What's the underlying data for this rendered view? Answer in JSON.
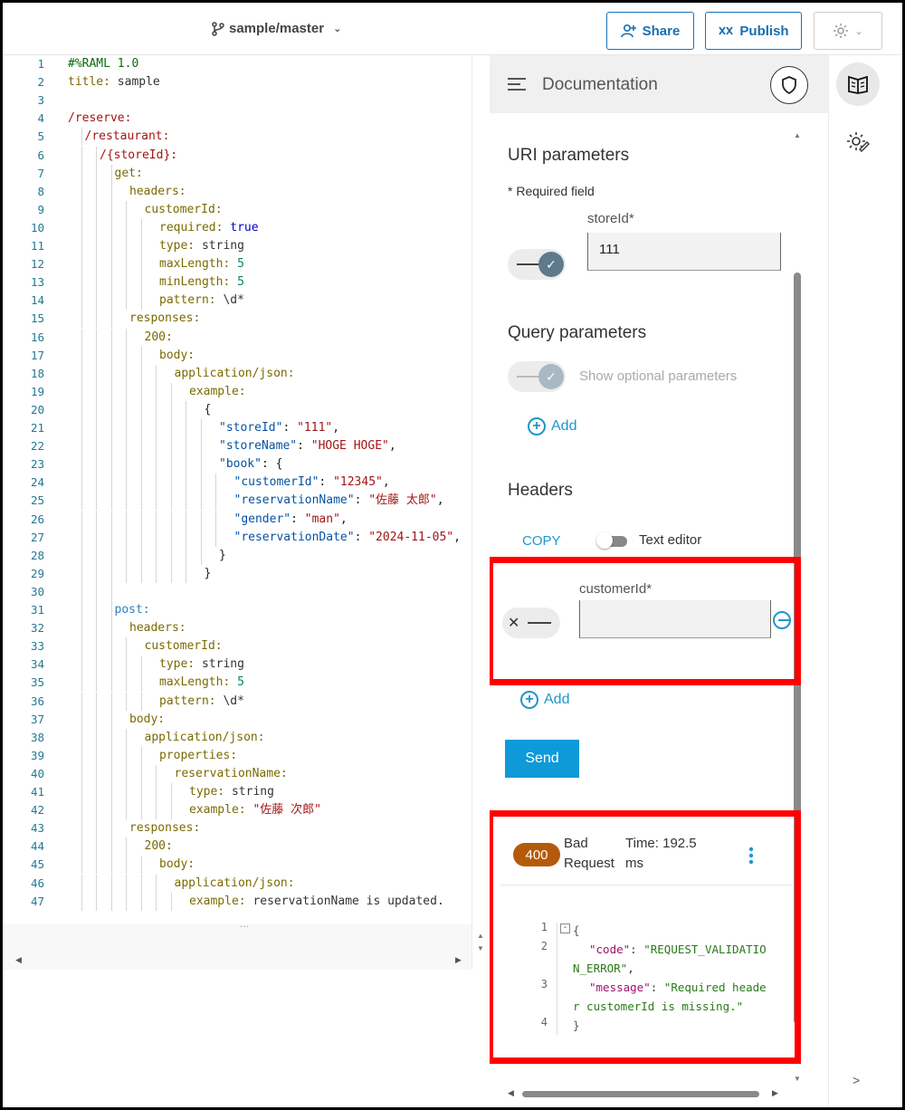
{
  "topbar": {
    "branch": "sample/master",
    "share_label": "Share",
    "publish_label": "Publish"
  },
  "editor": {
    "lines": [
      {
        "n": "1"
      },
      {
        "n": "2"
      },
      {
        "n": "3"
      },
      {
        "n": "4"
      },
      {
        "n": "5"
      },
      {
        "n": "6"
      },
      {
        "n": "7"
      },
      {
        "n": "8"
      },
      {
        "n": "9"
      },
      {
        "n": "10"
      },
      {
        "n": "11"
      },
      {
        "n": "12"
      },
      {
        "n": "13"
      },
      {
        "n": "14"
      },
      {
        "n": "15"
      },
      {
        "n": "16"
      },
      {
        "n": "17"
      },
      {
        "n": "18"
      },
      {
        "n": "19"
      },
      {
        "n": "20"
      },
      {
        "n": "21"
      },
      {
        "n": "22"
      },
      {
        "n": "23"
      },
      {
        "n": "24"
      },
      {
        "n": "25"
      },
      {
        "n": "26"
      },
      {
        "n": "27"
      },
      {
        "n": "28"
      },
      {
        "n": "29"
      },
      {
        "n": "30"
      },
      {
        "n": "31"
      },
      {
        "n": "32"
      },
      {
        "n": "33"
      },
      {
        "n": "34"
      },
      {
        "n": "35"
      },
      {
        "n": "36"
      },
      {
        "n": "37"
      },
      {
        "n": "38"
      },
      {
        "n": "39"
      },
      {
        "n": "40"
      },
      {
        "n": "41"
      },
      {
        "n": "42"
      },
      {
        "n": "43"
      },
      {
        "n": "44"
      },
      {
        "n": "45"
      },
      {
        "n": "46"
      },
      {
        "n": "47"
      }
    ],
    "code": {
      "l1": "#%RAML 1.0",
      "l2a": "title:",
      "l2b": " sample",
      "l4": "/reserve:",
      "l5": "/restaurant:",
      "l6": "/{storeId}:",
      "l7": "get:",
      "l8": "headers:",
      "l9": "customerId:",
      "l10a": "required:",
      "l10b": " true",
      "l11a": "type:",
      "l11b": " string",
      "l12a": "maxLength:",
      "l12b": " 5",
      "l13a": "minLength:",
      "l13b": " 5",
      "l14a": "pattern:",
      "l14b": " \\d*",
      "l15": "responses:",
      "l16": "200:",
      "l17": "body:",
      "l18": "application/json:",
      "l19": "example:",
      "l20": "{",
      "l21a": "\"storeId\"",
      "l21b": ": ",
      "l21c": "\"111\"",
      "l21d": ",",
      "l22a": "\"storeName\"",
      "l22b": ": ",
      "l22c": "\"HOGE HOGE\"",
      "l22d": ",",
      "l23a": "\"book\"",
      "l23b": ": {",
      "l24a": "\"customerId\"",
      "l24b": ": ",
      "l24c": "\"12345\"",
      "l24d": ",",
      "l25a": "\"reservationName\"",
      "l25b": ": ",
      "l25c": "\"佐藤 太郎\"",
      "l25d": ",",
      "l26a": "\"gender\"",
      "l26b": ": ",
      "l26c": "\"man\"",
      "l26d": ",",
      "l27a": "\"reservationDate\"",
      "l27b": ": ",
      "l27c": "\"2024-11-05\"",
      "l27d": ",",
      "l28": "}",
      "l29": "}",
      "l31": "post:",
      "l32": "headers:",
      "l33": "customerId:",
      "l34a": "type:",
      "l34b": " string",
      "l35a": "maxLength:",
      "l35b": " 5",
      "l36a": "pattern:",
      "l36b": " \\d*",
      "l37": "body:",
      "l38": "application/json:",
      "l39": "properties:",
      "l40": "reservationName:",
      "l41a": "type:",
      "l41b": " string",
      "l42a": "example:",
      "l42b": " \"佐藤 次郎\"",
      "l43": "responses:",
      "l44": "200:",
      "l45": "body:",
      "l46": "application/json:",
      "l47a": "example:",
      "l47b": " reservationName is updated."
    },
    "fold_dots": "..."
  },
  "doc": {
    "title": "Documentation",
    "uri_title": "URI parameters",
    "required_note": "* Required field",
    "storeid_label": "storeId*",
    "storeid_value": "111",
    "query_title": "Query parameters",
    "show_optional": "Show optional parameters",
    "add_label": "Add",
    "headers_title": "Headers",
    "copy_label": "COPY",
    "text_editor_label": "Text editor",
    "customerid_label": "customerId*",
    "customerid_value": "",
    "send_label": "Send",
    "response": {
      "status_code": "400",
      "status_line1": "Bad",
      "status_line2": "Request",
      "time_line1": "Time: 192.5",
      "time_line2": "ms",
      "lines": [
        "1",
        "2",
        "3",
        "4"
      ],
      "r1": "{",
      "r2a": "\"code\"",
      "r2b": ": ",
      "r2c": "\"REQUEST_VALIDATIO",
      "r2d": "N_ERROR\"",
      "r2e": ",",
      "r3a": "\"message\"",
      "r3b": ": ",
      "r3c": "\"Required heade",
      "r3d": "r customerId is missing.\"",
      "r4": "}"
    }
  },
  "rail": {
    "expand": ">"
  },
  "colors": {
    "accent": "#0e9ad8",
    "status_error": "#b55a0a",
    "highlight": "#ff0000"
  }
}
